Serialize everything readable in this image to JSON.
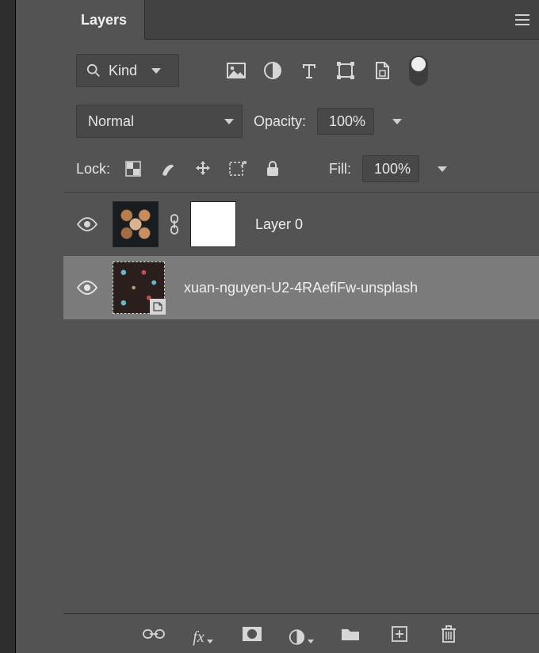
{
  "panel": {
    "title": "Layers"
  },
  "filter": {
    "kind_label": "Kind"
  },
  "blend": {
    "mode": "Normal",
    "opacity_label": "Opacity:",
    "opacity_value": "100%"
  },
  "lock": {
    "label": "Lock:",
    "fill_label": "Fill:",
    "fill_value": "100%"
  },
  "layers": [
    {
      "name": "Layer 0",
      "selected": false
    },
    {
      "name": "xuan-nguyen-U2-4RAefiFw-unsplash",
      "selected": true
    }
  ],
  "icons": {
    "image": "image-icon",
    "adjust": "adjustment-icon",
    "type": "type-icon",
    "shape": "shape-icon",
    "smart": "smartobject-icon"
  }
}
